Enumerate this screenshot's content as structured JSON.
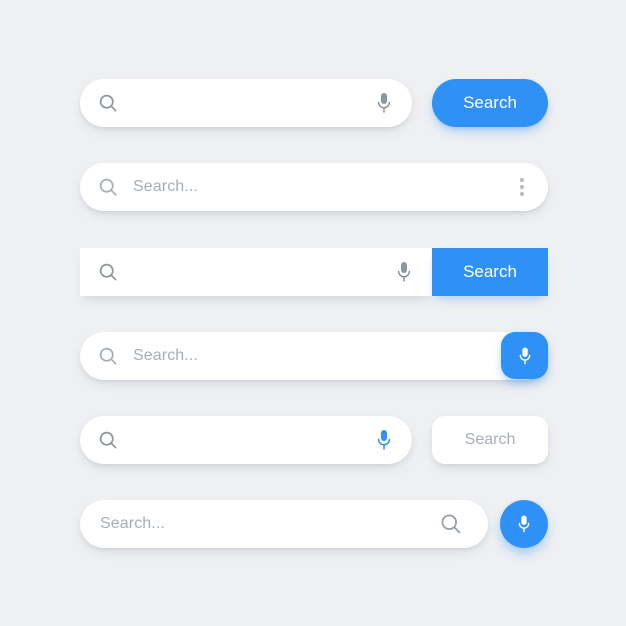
{
  "page": {
    "background_color": "#eff0f2",
    "accent_color": "#2f91f5",
    "field_color": "#ffffff",
    "placeholder_color": "#a6aeb7",
    "icon_gray": "#8d959e"
  },
  "rows": [
    {
      "id": "row-1",
      "variant": "pill-field-with-detached-blue-pill-button",
      "placeholder": "",
      "search_icon": "search-icon",
      "mic_icon": "microphone-icon",
      "mic_color": "#8d959e",
      "button_label": "Search",
      "button_style": "blue-pill"
    },
    {
      "id": "row-2",
      "variant": "wide-pill-field-with-overflow-menu",
      "placeholder": "Search...",
      "search_icon": "search-icon",
      "menu_icon": "more-vertical-icon",
      "button_label": "",
      "button_style": "none"
    },
    {
      "id": "row-3",
      "variant": "square-field-with-attached-blue-button",
      "placeholder": "",
      "search_icon": "search-icon",
      "mic_icon": "microphone-icon",
      "mic_color": "#8d959e",
      "button_label": "Search",
      "button_style": "blue-square"
    },
    {
      "id": "row-4",
      "variant": "wide-pill-field-with-inset-blue-mic-button",
      "placeholder": "Search...",
      "search_icon": "search-icon",
      "mic_icon": "microphone-icon",
      "mic_color": "#ffffff",
      "button_label": "",
      "button_style": "blue-rounded-square"
    },
    {
      "id": "row-5",
      "variant": "pill-field-with-detached-white-button",
      "placeholder": "",
      "search_icon": "search-icon",
      "mic_icon": "microphone-icon",
      "mic_color": "#2f91f5",
      "button_label": "Search",
      "button_style": "white-rounded"
    },
    {
      "id": "row-6",
      "variant": "pill-field-trailing-search-icon-with-blue-circle-mic",
      "placeholder": "Search...",
      "search_icon": "search-icon",
      "mic_icon": "microphone-icon",
      "mic_color": "#ffffff",
      "button_label": "",
      "button_style": "blue-circle"
    }
  ]
}
